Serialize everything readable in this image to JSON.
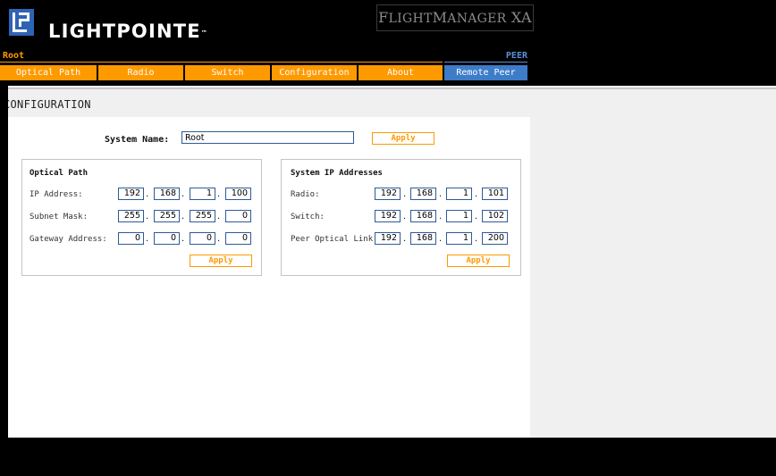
{
  "brand": {
    "name": "LIGHTPOINTE",
    "tm": "™"
  },
  "product": {
    "f": "F",
    "light": "LIGHT",
    "m": "M",
    "anager": "ANAGER",
    "xa": " XA"
  },
  "header": {
    "root_label": "Root",
    "peer_label": "PEER"
  },
  "tabs": [
    "Optical Path",
    "Radio",
    "Switch",
    "Configuration",
    "About",
    "Remote Peer"
  ],
  "colors": {
    "accent": "#ff9900",
    "peer": "#3d7cc9",
    "background": "#000000"
  },
  "page_title": "CONFIGURATION",
  "system_name": {
    "label": "System Name:",
    "value": "Root",
    "apply": "Apply"
  },
  "optical_path": {
    "title": "Optical Path",
    "rows": [
      {
        "label": "IP Address:",
        "octets": [
          "192",
          "168",
          "1",
          "100"
        ]
      },
      {
        "label": "Subnet Mask:",
        "octets": [
          "255",
          "255",
          "255",
          "0"
        ]
      },
      {
        "label": "Gateway Address:",
        "octets": [
          "0",
          "0",
          "0",
          "0"
        ]
      }
    ],
    "apply": "Apply"
  },
  "system_ip": {
    "title": "System IP Addresses",
    "rows": [
      {
        "label": "Radio:",
        "octets": [
          "192",
          "168",
          "1",
          "101"
        ]
      },
      {
        "label": "Switch:",
        "octets": [
          "192",
          "168",
          "1",
          "102"
        ]
      },
      {
        "label": "Peer Optical Link:",
        "octets": [
          "192",
          "168",
          "1",
          "200"
        ]
      }
    ],
    "apply": "Apply"
  },
  "icons": {
    "logo": "lightpointe-logo-icon"
  }
}
